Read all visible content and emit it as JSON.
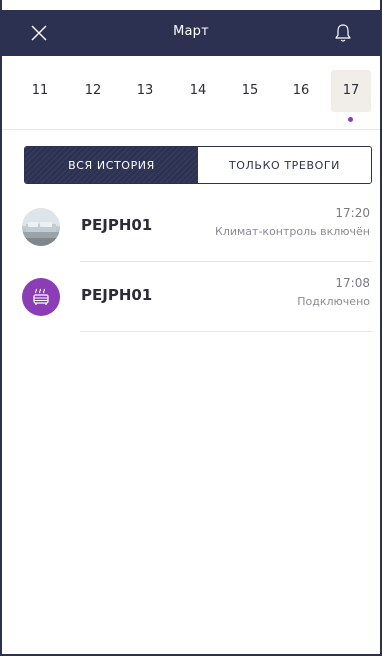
{
  "header": {
    "title": "Март",
    "close_icon": "close-icon",
    "bell_icon": "bell-icon",
    "background": "#2c3152"
  },
  "dates": [
    {
      "label": "11",
      "active": false
    },
    {
      "label": "12",
      "active": false
    },
    {
      "label": "13",
      "active": false
    },
    {
      "label": "14",
      "active": false
    },
    {
      "label": "15",
      "active": false
    },
    {
      "label": "16",
      "active": false
    },
    {
      "label": "17",
      "active": true,
      "has_events": true
    }
  ],
  "tabs": {
    "all_history": "ВСЯ ИСТОРИЯ",
    "alarms_only": "ТОЛЬКО ТРЕВОГИ",
    "selected": "all_history"
  },
  "history": [
    {
      "device": "PEJPH01",
      "time": "17:20",
      "status": "Климат-контроль включён",
      "avatar": "room-photo"
    },
    {
      "device": "PEJPH01",
      "time": "17:08",
      "status": "Подключено",
      "avatar": "heater-icon"
    }
  ],
  "colors": {
    "accent": "#8b3db5",
    "navy": "#2c3152",
    "active_date_bg": "#f1ede8"
  }
}
